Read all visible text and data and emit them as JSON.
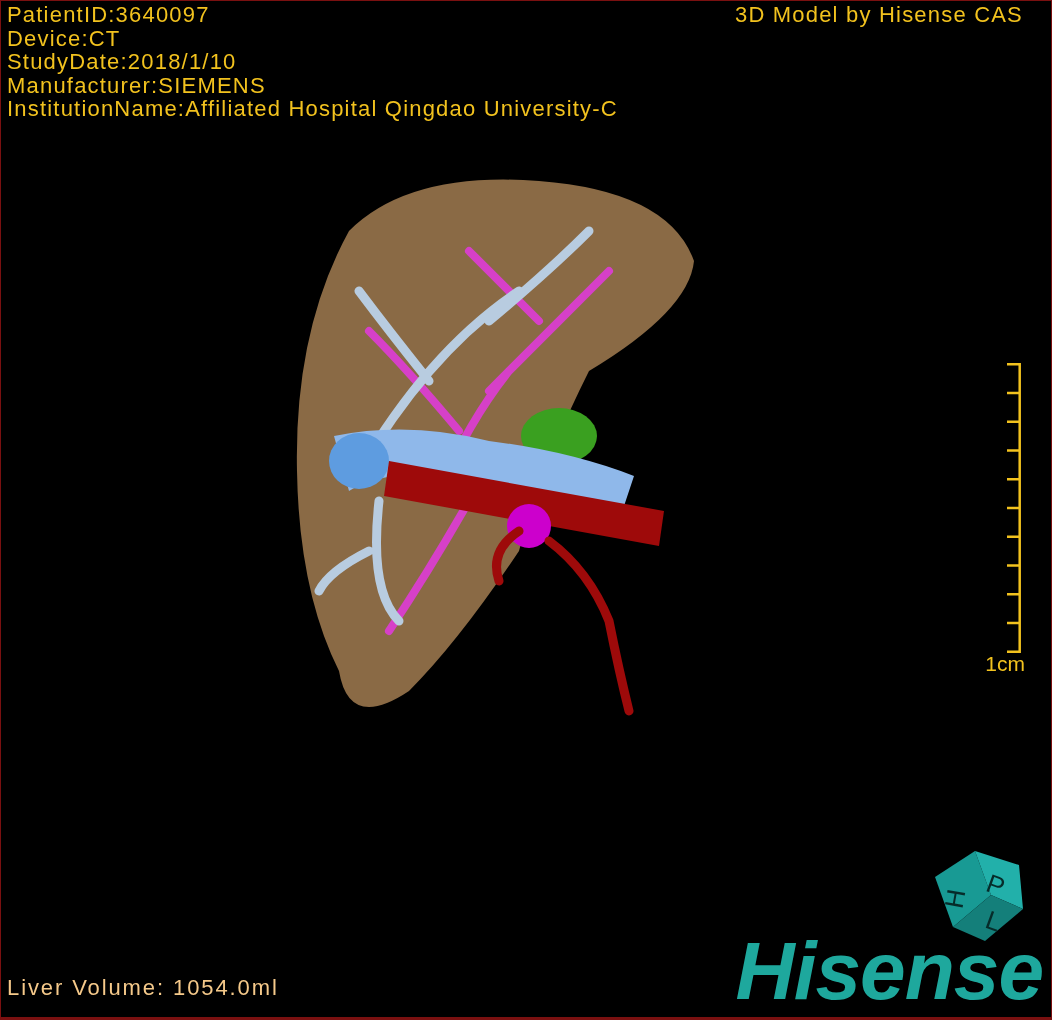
{
  "header": {
    "info_lines": [
      "PatientID:3640097",
      "Device:CT",
      "StudyDate:2018/1/10",
      "Manufacturer:SIEMENS",
      "InstitutionName:Affiliated Hospital Qingdao University-C"
    ],
    "title": "3D Model by Hisense CAS"
  },
  "scale": {
    "label": "1cm"
  },
  "orientation_cube": {
    "faces": [
      "H",
      "P",
      "L"
    ]
  },
  "footer": {
    "liver_volume": "Liver Volume: 1054.0ml",
    "logo": "Hisense"
  }
}
